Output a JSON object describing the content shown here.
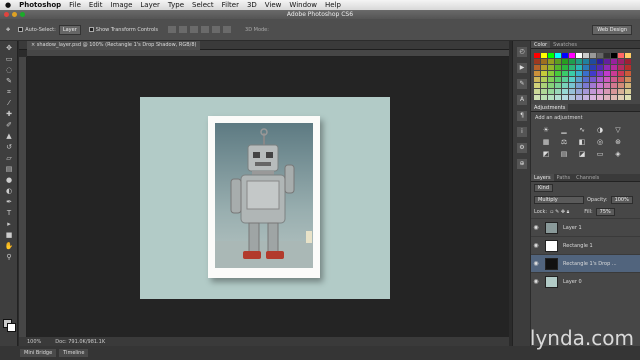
{
  "menubar": {
    "app": "Photoshop",
    "items": [
      "File",
      "Edit",
      "Image",
      "Layer",
      "Type",
      "Select",
      "Filter",
      "3D",
      "View",
      "Window",
      "Help"
    ]
  },
  "window_title": "Adobe Photoshop CS6",
  "options": {
    "auto_select_label": "Auto-Select:",
    "auto_select_value": "Layer",
    "transform_label": "Show Transform Controls",
    "mode_label": "3D Mode:",
    "workspace": "Web Design"
  },
  "document": {
    "tab_label": "shadow_layer.psd @ 100% (Rectangle 1's Drop Shadow, RGB/8)"
  },
  "status": {
    "zoom": "100%",
    "doc_size": "Doc: 791.0K/981.1K"
  },
  "bottom_tabs": [
    "Mini Bridge",
    "Timeline"
  ],
  "panels": {
    "color_tabs": [
      "Color",
      "Swatches"
    ],
    "adjust_tab": "Adjustments",
    "adjust_title": "Add an adjustment",
    "layer_tabs": [
      "Layers",
      "Paths",
      "Channels"
    ],
    "filter": "Kind",
    "blend": "Multiply",
    "opacity_label": "Opacity:",
    "opacity": "100%",
    "lock_label": "Lock:",
    "fill_label": "Fill:",
    "fill": "75%",
    "layers": [
      {
        "name": "Layer 1",
        "selected": false
      },
      {
        "name": "Rectangle 1",
        "selected": false
      },
      {
        "name": "Rectangle 1's Drop ...",
        "selected": true
      },
      {
        "name": "Layer 0",
        "selected": false
      }
    ]
  },
  "watermark": "lynda.com",
  "colors": {
    "canvas_bg": "#b2cbc7",
    "selection": "#51647d"
  }
}
